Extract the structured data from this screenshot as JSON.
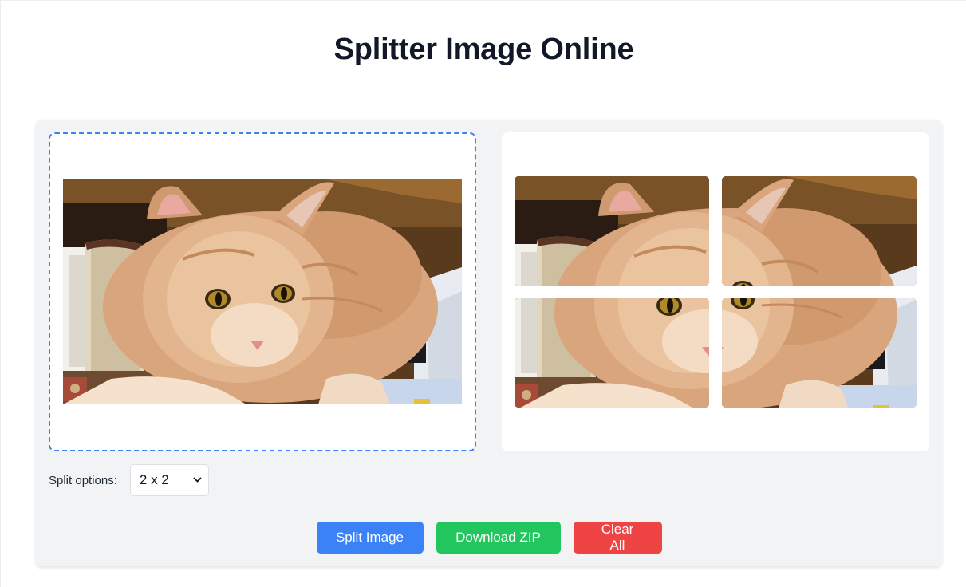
{
  "page": {
    "title": "Splitter Image Online"
  },
  "source_image": {
    "alt": "cat photo"
  },
  "split": {
    "label": "Split options:",
    "selected": "2 x 2",
    "rows": 2,
    "cols": 2
  },
  "buttons": {
    "split": "Split Image",
    "download": "Download ZIP",
    "clear": "Clear All"
  },
  "colors": {
    "accent_blue": "#3b82f6",
    "green": "#22c55e",
    "red": "#ef4444",
    "panel_bg": "#f2f3f5"
  }
}
